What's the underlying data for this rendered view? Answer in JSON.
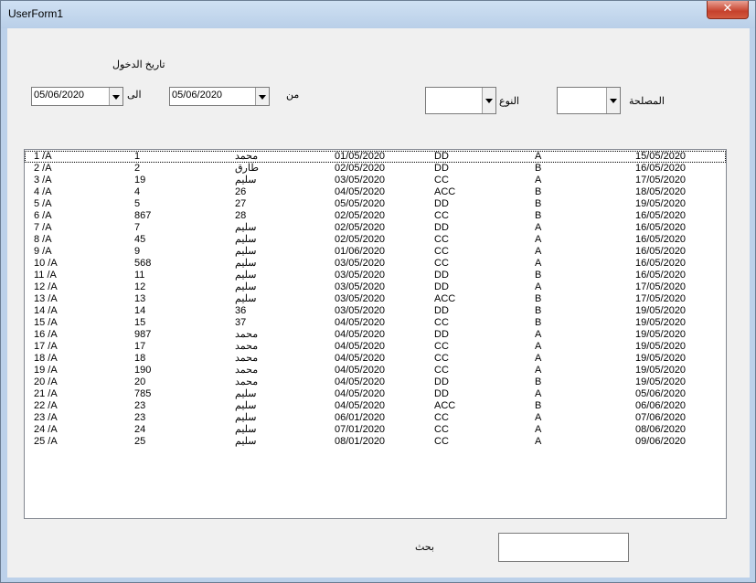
{
  "window": {
    "title": "UserForm1",
    "close_glyph": "✕"
  },
  "filters": {
    "entry_date_label": "تاريخ الدخول",
    "to_label": "الى",
    "from_label": "من",
    "to_date": "05/06/2020",
    "from_date": "05/06/2020",
    "type_label": "النوع",
    "type_value": "",
    "department_label": "المصلحة",
    "department_value": ""
  },
  "list": {
    "rows": [
      [
        "1 /A",
        "1",
        "محمد",
        "01/05/2020",
        "DD",
        "A",
        "15/05/2020"
      ],
      [
        "2 /A",
        "2",
        "طارق",
        "02/05/2020",
        "DD",
        "B",
        "16/05/2020"
      ],
      [
        "3 /A",
        "19",
        "سليم",
        "03/05/2020",
        "CC",
        "A",
        "17/05/2020"
      ],
      [
        "4 /A",
        "4",
        "26",
        "04/05/2020",
        "ACC",
        "B",
        "18/05/2020"
      ],
      [
        "5 /A",
        "5",
        "27",
        "05/05/2020",
        "DD",
        "B",
        "19/05/2020"
      ],
      [
        "6 /A",
        "867",
        "28",
        "02/05/2020",
        "CC",
        "B",
        "16/05/2020"
      ],
      [
        "7 /A",
        "7",
        "سليم",
        "02/05/2020",
        "DD",
        "A",
        "16/05/2020"
      ],
      [
        "8 /A",
        "45",
        "سليم",
        "02/05/2020",
        "CC",
        "A",
        "16/05/2020"
      ],
      [
        "9 /A",
        "9",
        "سليم",
        "01/06/2020",
        "CC",
        "A",
        "16/05/2020"
      ],
      [
        "10 /A",
        "568",
        "سليم",
        "03/05/2020",
        "CC",
        "A",
        "16/05/2020"
      ],
      [
        "11 /A",
        "11",
        "سليم",
        "03/05/2020",
        "DD",
        "B",
        "16/05/2020"
      ],
      [
        "12 /A",
        "12",
        "سليم",
        "03/05/2020",
        "DD",
        "A",
        "17/05/2020"
      ],
      [
        "13 /A",
        "13",
        "سليم",
        "03/05/2020",
        "ACC",
        "B",
        "17/05/2020"
      ],
      [
        "14 /A",
        "14",
        "36",
        "03/05/2020",
        "DD",
        "B",
        "19/05/2020"
      ],
      [
        "15 /A",
        "15",
        "37",
        "04/05/2020",
        "CC",
        "B",
        "19/05/2020"
      ],
      [
        "16 /A",
        "987",
        "محمد",
        "04/05/2020",
        "DD",
        "A",
        "19/05/2020"
      ],
      [
        "17 /A",
        "17",
        "محمد",
        "04/05/2020",
        "CC",
        "A",
        "19/05/2020"
      ],
      [
        "18 /A",
        "18",
        "محمد",
        "04/05/2020",
        "CC",
        "A",
        "19/05/2020"
      ],
      [
        "19 /A",
        "190",
        "محمد",
        "04/05/2020",
        "CC",
        "A",
        "19/05/2020"
      ],
      [
        "20 /A",
        "20",
        "محمد",
        "04/05/2020",
        "DD",
        "B",
        "19/05/2020"
      ],
      [
        "21 /A",
        "785",
        "سليم",
        "04/05/2020",
        "DD",
        "A",
        "05/06/2020"
      ],
      [
        "22 /A",
        "23",
        "سليم",
        "04/05/2020",
        "ACC",
        "B",
        "06/06/2020"
      ],
      [
        "23 /A",
        "23",
        "سليم",
        "06/01/2020",
        "CC",
        "A",
        "07/06/2020"
      ],
      [
        "24 /A",
        "24",
        "سليم",
        "07/01/2020",
        "CC",
        "A",
        "08/06/2020"
      ],
      [
        "25 /A",
        "25",
        "سليم",
        "08/01/2020",
        "CC",
        "A",
        "09/06/2020"
      ]
    ]
  },
  "search": {
    "label": "بحث",
    "value": ""
  }
}
